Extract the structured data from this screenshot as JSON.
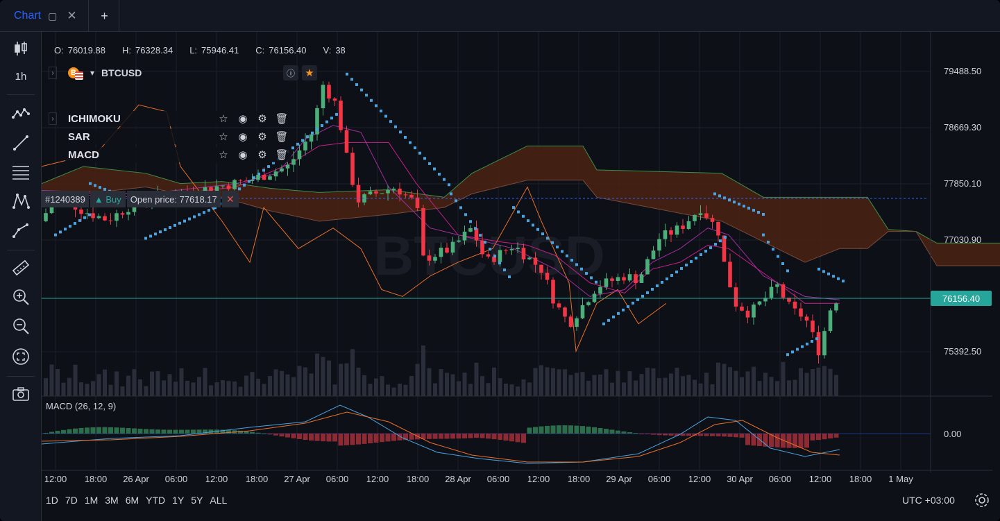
{
  "tabs": {
    "chart_label": "Chart",
    "add_label": "+"
  },
  "toolbar": {
    "timeframe": "1h",
    "icons": [
      "candlestick-icon",
      "trend-lines-icon",
      "line-tool-icon",
      "horizontal-lines-icon",
      "pattern-icon",
      "path-icon",
      "ruler-icon",
      "zoom-in-icon",
      "zoom-out-icon",
      "fit-screen-icon",
      "camera-icon"
    ]
  },
  "legend": {
    "o_label": "O:",
    "o_value": "76019.88",
    "h_label": "H:",
    "h_value": "76328.34",
    "l_label": "L:",
    "l_value": "75946.41",
    "c_label": "C:",
    "c_value": "76156.40",
    "v_label": "V:",
    "v_value": "38"
  },
  "symbol": {
    "name": "BTCUSD",
    "logo_glyph": "B",
    "watermark": "BTCUSD"
  },
  "indicators": [
    {
      "name": "ICHIMOKU"
    },
    {
      "name": "SAR"
    },
    {
      "name": "MACD"
    }
  ],
  "order": {
    "id": "#1240389",
    "side": "▲ Buy",
    "open_price": "Open price: 77618.17",
    "close_glyph": "✕"
  },
  "price_scale": {
    "labels": [
      "79488.50",
      "78669.30",
      "77850.10",
      "77030.90",
      "75392.50"
    ],
    "last_price": "76156.40",
    "macd_zero": "0.00"
  },
  "macd_pane": {
    "title": "MACD (26, 12, 9)"
  },
  "time_axis": [
    "12:00",
    "18:00",
    "26 Apr",
    "06:00",
    "12:00",
    "18:00",
    "27 Apr",
    "06:00",
    "12:00",
    "18:00",
    "28 Apr",
    "06:00",
    "12:00",
    "18:00",
    "29 Apr",
    "06:00",
    "12:00",
    "30 Apr",
    "06:00",
    "12:00",
    "18:00",
    "1 May"
  ],
  "ranges": [
    "1D",
    "7D",
    "1M",
    "3M",
    "6M",
    "YTD",
    "1Y",
    "5Y",
    "ALL"
  ],
  "timezone": "UTC +03:00",
  "colors": {
    "up": "#4caf7a",
    "down": "#f23645",
    "accent": "#2962ff",
    "sar": "#4aa3df",
    "cloud": "#4a2313"
  }
}
